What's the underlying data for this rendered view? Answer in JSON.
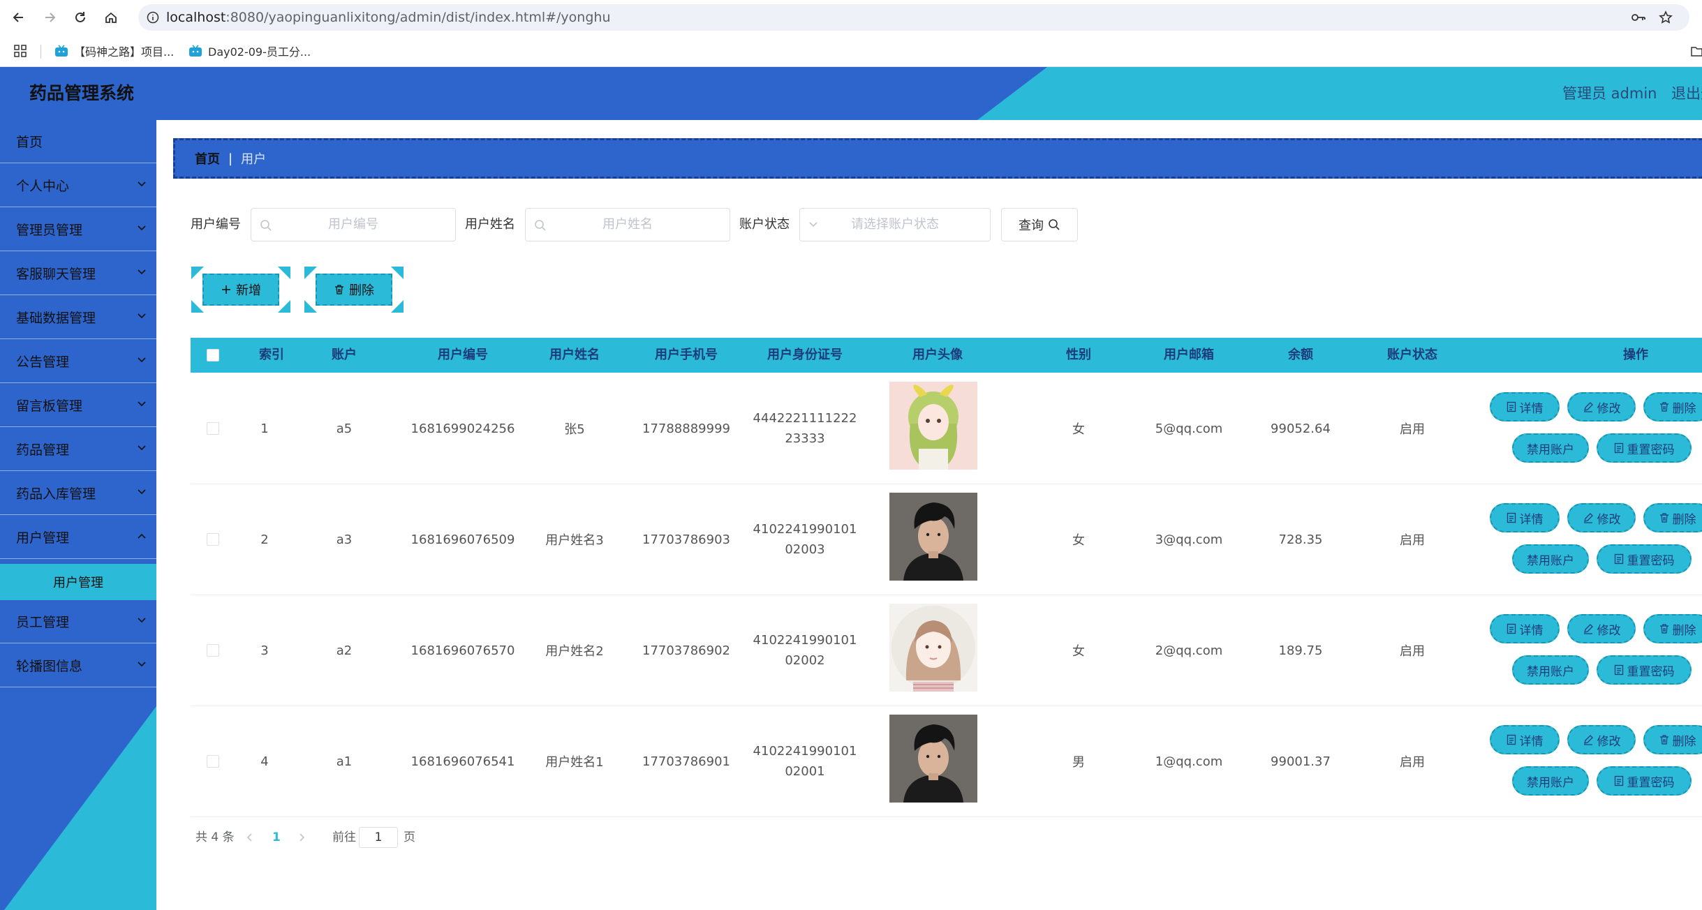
{
  "browser": {
    "url_host": "localhost",
    "url_rest": ":8080/yaopinguanlixitong/admin/dist/index.html#/yonghu",
    "bookmarks": [
      {
        "label": "【码神之路】项目..."
      },
      {
        "label": "Day02-09-员工分..."
      }
    ]
  },
  "header": {
    "title": "药品管理系统",
    "admin": "管理员 admin",
    "logout": "退出登"
  },
  "sidebar": {
    "items": [
      {
        "label": "首页"
      },
      {
        "label": "个人中心"
      },
      {
        "label": "管理员管理"
      },
      {
        "label": "客服聊天管理"
      },
      {
        "label": "基础数据管理"
      },
      {
        "label": "公告管理"
      },
      {
        "label": "留言板管理"
      },
      {
        "label": "药品管理"
      },
      {
        "label": "药品入库管理"
      },
      {
        "label": "用户管理"
      },
      {
        "label": "员工管理"
      },
      {
        "label": "轮播图信息"
      }
    ],
    "active_sub": "用户管理"
  },
  "breadcrumb": {
    "home": "首页",
    "current": "用户"
  },
  "filters": {
    "user_no_label": "用户编号",
    "user_no_placeholder": "用户编号",
    "user_name_label": "用户姓名",
    "user_name_placeholder": "用户姓名",
    "status_label": "账户状态",
    "status_placeholder": "请选择账户状态",
    "query_label": "查询"
  },
  "actions": {
    "add": "新增",
    "delete": "删除"
  },
  "table": {
    "columns": [
      "索引",
      "账户",
      "用户编号",
      "用户姓名",
      "用户手机号",
      "用户身份证号",
      "用户头像",
      "性别",
      "用户邮箱",
      "余额",
      "账户状态",
      "操作"
    ],
    "rows": [
      {
        "index": "1",
        "account": "a5",
        "user_no": "1681699024256",
        "name": "张5",
        "phone": "17788889999",
        "id_card_1": "4442221111222",
        "id_card_2": "23333",
        "gender": "女",
        "email": "5@qq.com",
        "balance": "99052.64",
        "status": "启用",
        "avatar": "anime-girl"
      },
      {
        "index": "2",
        "account": "a3",
        "user_no": "1681696076509",
        "name": "用户姓名3",
        "phone": "17703786903",
        "id_card_1": "4102241990101",
        "id_card_2": "02003",
        "gender": "女",
        "email": "3@qq.com",
        "balance": "728.35",
        "status": "启用",
        "avatar": "man"
      },
      {
        "index": "3",
        "account": "a2",
        "user_no": "1681696076570",
        "name": "用户姓名2",
        "phone": "17703786902",
        "id_card_1": "4102241990101",
        "id_card_2": "02002",
        "gender": "女",
        "email": "2@qq.com",
        "balance": "189.75",
        "status": "启用",
        "avatar": "girl-sketch"
      },
      {
        "index": "4",
        "account": "a1",
        "user_no": "1681696076541",
        "name": "用户姓名1",
        "phone": "17703786901",
        "id_card_1": "4102241990101",
        "id_card_2": "02001",
        "gender": "男",
        "email": "1@qq.com",
        "balance": "99001.37",
        "status": "启用",
        "avatar": "man"
      }
    ],
    "ops": {
      "detail": "详情",
      "edit": "修改",
      "delete": "删除",
      "disable": "禁用账户",
      "reset": "重置密码"
    }
  },
  "pagination": {
    "total": "共 4 条",
    "current": "1",
    "goto": "前往",
    "page_value": "1",
    "page_suffix": "页"
  },
  "colors": {
    "primary": "#2e65cc",
    "accent": "#2bbad8"
  }
}
